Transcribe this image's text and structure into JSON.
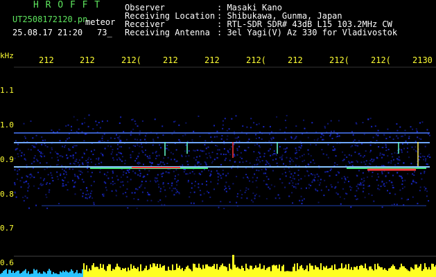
{
  "header": {
    "app_name": "H R O F F T",
    "filename": "UT2508172120.pn",
    "tag": "meteor",
    "datetime": "25.08.17 21:20",
    "count": "73_",
    "fields": [
      {
        "label": "Observer",
        "value": ": Masaki Kano"
      },
      {
        "label": "Receiving Location",
        "value": ": Shibukawa, Gunma, Japan"
      },
      {
        "label": "Receiver",
        "value": ": RTL-SDR SDR# 43dB L15 103.2MHz CW"
      },
      {
        "label": "Receiving Antenna",
        "value": ": 3el Yagi(V) Az 330 for Vladivostok"
      }
    ]
  },
  "axis": {
    "unit": "kHz",
    "x_ticks": [
      "212",
      "212",
      "212(",
      "212",
      "212",
      "212(",
      "212",
      "212(",
      "212(",
      "2130"
    ],
    "y_ticks": [
      "1.1",
      "1.0",
      "0.9",
      "0.8",
      "0.7",
      "0.6"
    ]
  },
  "colors": {
    "background": "#000000",
    "header_title": "#5ee65e",
    "axis_text": "#ffff33",
    "noise": "#1b2bd8",
    "signal": "#ff3b3b",
    "bar_cyan": "#29c2ff",
    "bar_yellow": "#ffff22"
  }
}
